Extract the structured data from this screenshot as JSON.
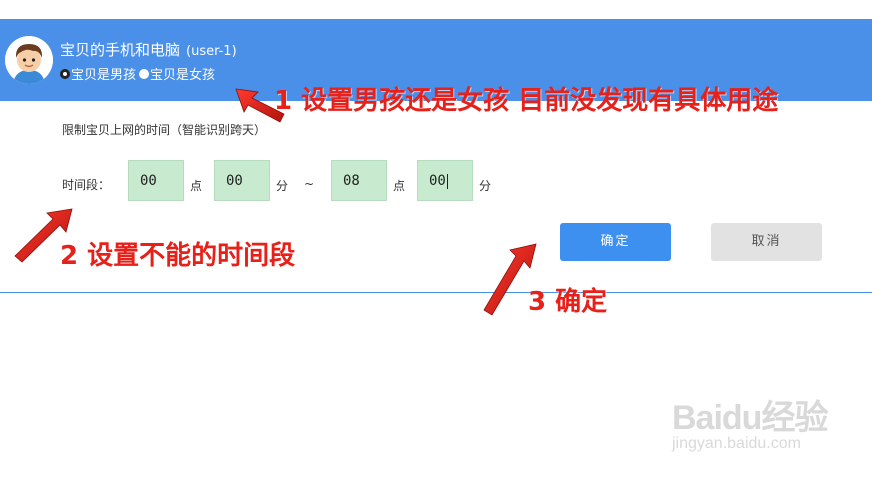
{
  "header": {
    "title": "宝贝的手机和电脑",
    "user": "(user-1)",
    "gender_options": [
      {
        "label": "宝贝是男孩",
        "selected": true
      },
      {
        "label": "宝贝是女孩",
        "selected": false
      }
    ],
    "bg_color": "#4a8fe8"
  },
  "form": {
    "limit_label": "限制宝贝上网的时间（智能识别跨天）",
    "period_label": "时间段：",
    "start_hour": "00",
    "start_minute": "00",
    "end_hour": "08",
    "end_minute": "00",
    "hour_unit": "点",
    "minute_unit": "分",
    "range_separator": "~"
  },
  "buttons": {
    "confirm": "确定",
    "cancel": "取消"
  },
  "annotations": {
    "a1": "1 设置男孩还是女孩 目前没发现有具体用途",
    "a2": "2 设置不能的时间段",
    "a3": "3 确定"
  },
  "watermark": {
    "logo": "Baidu经验",
    "site": "jingyan.baidu.com"
  },
  "icons": {
    "avatar": "boy-avatar-icon",
    "arrow": "red-arrow-icon"
  }
}
